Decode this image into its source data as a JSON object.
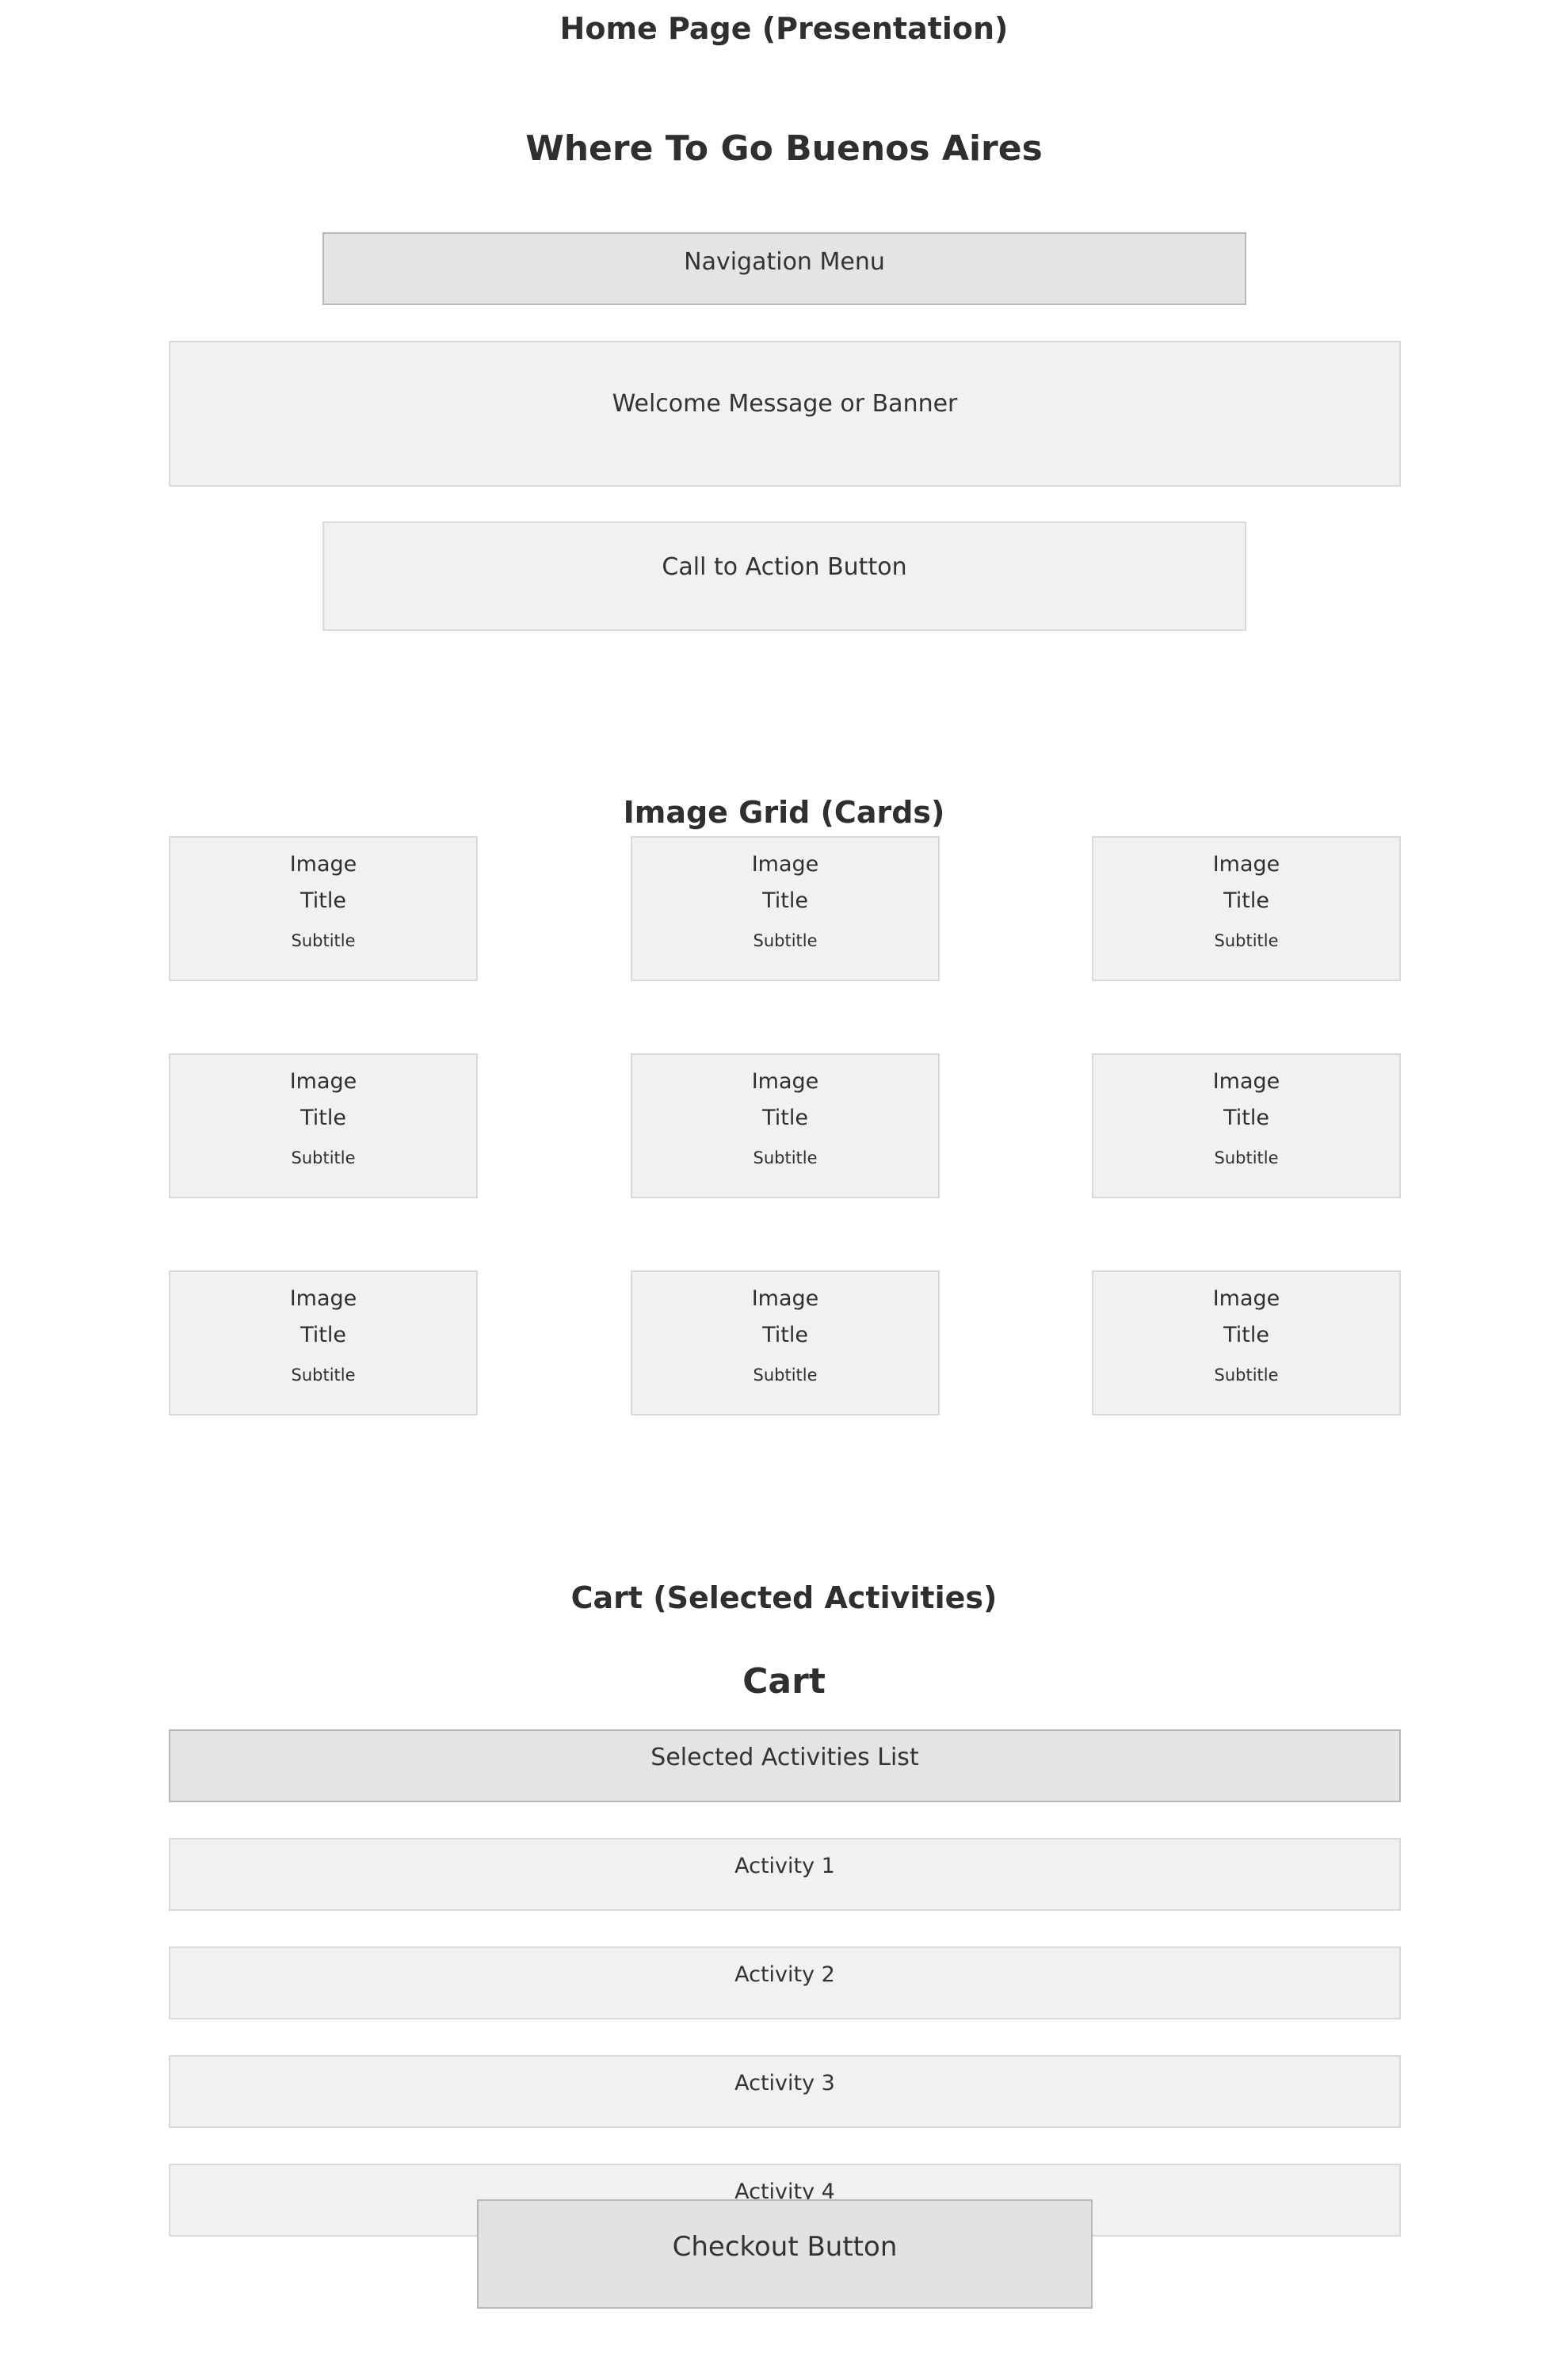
{
  "section1": {
    "heading": "Home Page (Presentation)",
    "site_title": "Where To Go Buenos Aires",
    "nav_menu": "Navigation Menu",
    "welcome_banner": "Welcome Message or Banner",
    "cta_button": "Call to Action Button"
  },
  "section2": {
    "heading": "Image Grid (Cards)",
    "cards": [
      {
        "image": "Image",
        "title": "Title",
        "subtitle": "Subtitle"
      },
      {
        "image": "Image",
        "title": "Title",
        "subtitle": "Subtitle"
      },
      {
        "image": "Image",
        "title": "Title",
        "subtitle": "Subtitle"
      },
      {
        "image": "Image",
        "title": "Title",
        "subtitle": "Subtitle"
      },
      {
        "image": "Image",
        "title": "Title",
        "subtitle": "Subtitle"
      },
      {
        "image": "Image",
        "title": "Title",
        "subtitle": "Subtitle"
      },
      {
        "image": "Image",
        "title": "Title",
        "subtitle": "Subtitle"
      },
      {
        "image": "Image",
        "title": "Title",
        "subtitle": "Subtitle"
      },
      {
        "image": "Image",
        "title": "Title",
        "subtitle": "Subtitle"
      }
    ]
  },
  "section3": {
    "heading": "Cart (Selected Activities)",
    "cart_title": "Cart",
    "list_header": "Selected Activities List",
    "activities": [
      "Activity 1",
      "Activity 2",
      "Activity 3",
      "Activity 4"
    ],
    "checkout_button": "Checkout Button"
  }
}
